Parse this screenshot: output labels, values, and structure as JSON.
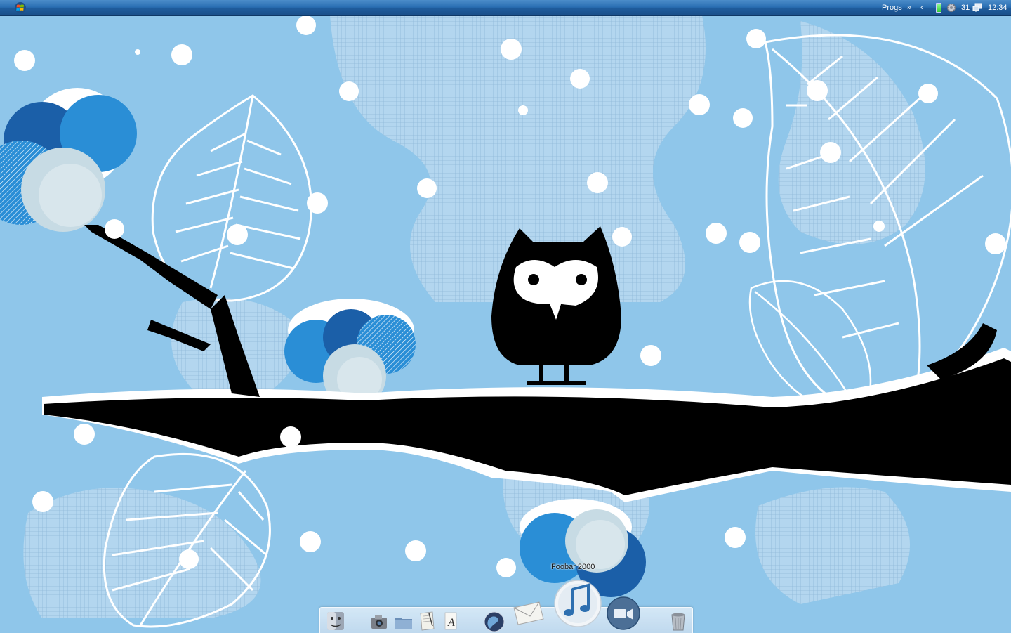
{
  "taskbar": {
    "progs_label": "Progs",
    "chevron_right": "»",
    "chevron_left": "‹",
    "date": "31",
    "clock": "12:34",
    "icons": [
      "start-logo-icon",
      "battery-icon",
      "gear-icon",
      "network-icon"
    ]
  },
  "dock": {
    "tooltip": "Foobar 2000",
    "items": [
      "finder-icon",
      "camera-icon",
      "folder-icon",
      "notes-icon",
      "font-icon",
      "globe-icon",
      "mail-icon",
      "music-icon",
      "video-icon",
      "trash-icon"
    ]
  },
  "colors": {
    "taskbar": "#2a6fb3",
    "sky": "#8fc6ea",
    "branch": "#000000",
    "flower_blue": "#2a8ed6",
    "flower_dark": "#1b5fa8",
    "snow": "#ffffff"
  }
}
